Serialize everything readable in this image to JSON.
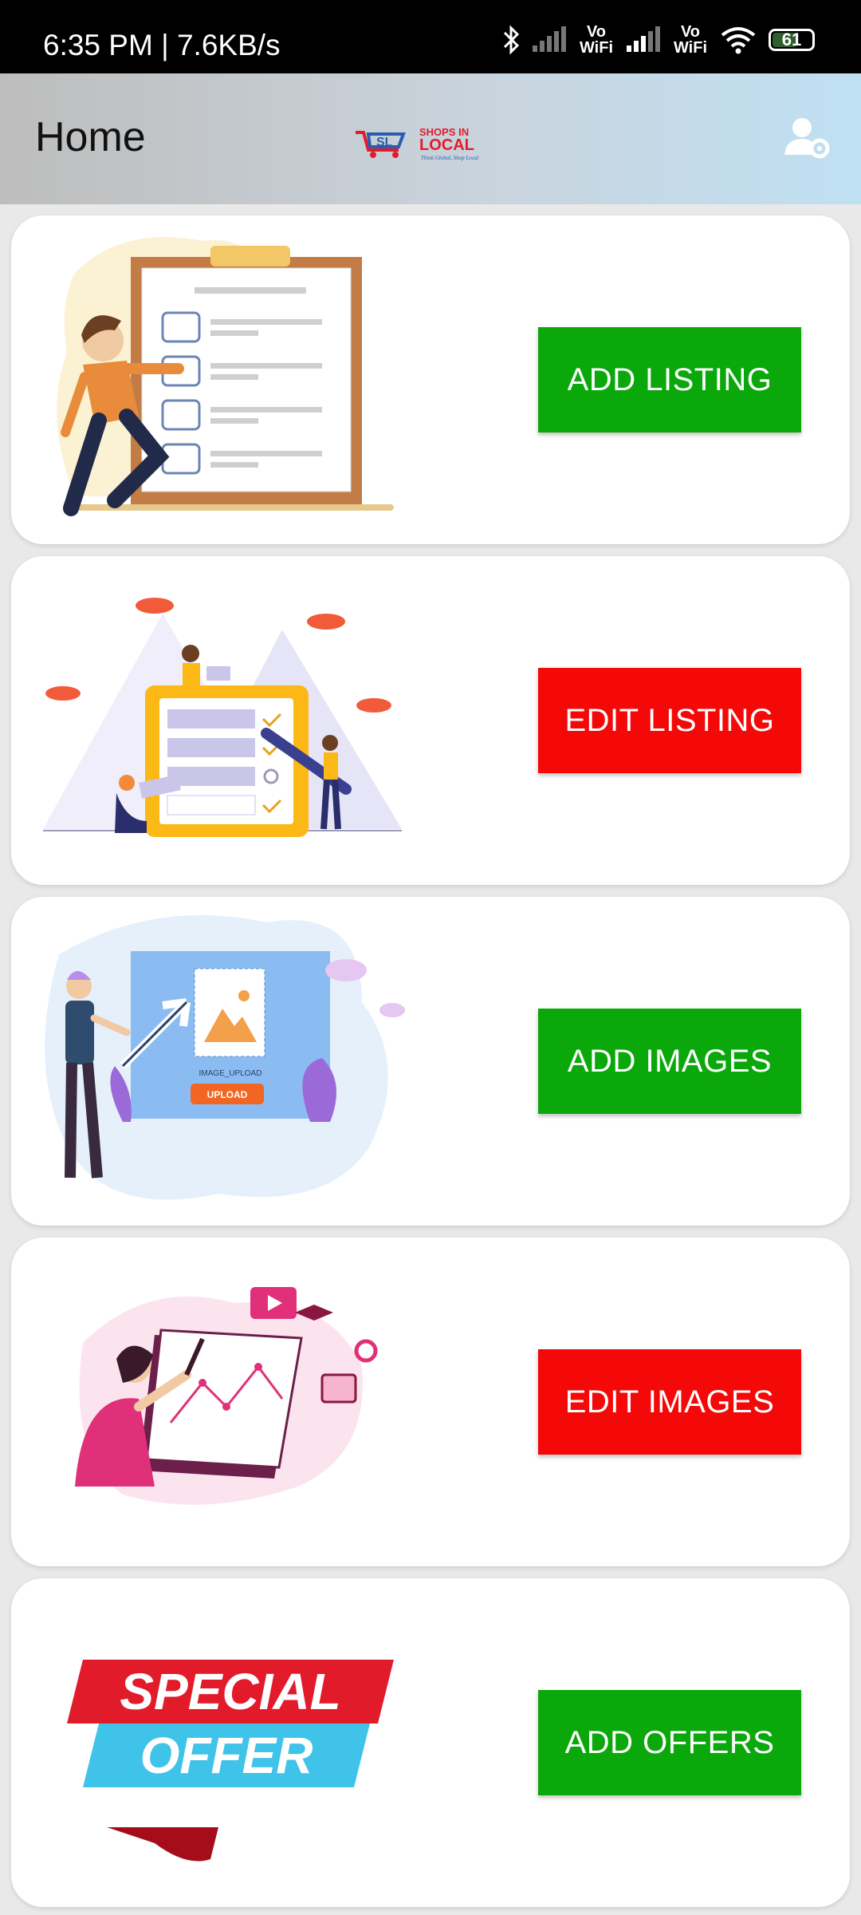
{
  "status_bar": {
    "time_speed": "6:35 PM | 7.6KB/s",
    "vo_wifi_1": "Vo WiFi",
    "vo_wifi_2": "Vo WiFi",
    "battery": "61"
  },
  "header": {
    "title": "Home",
    "logo_text_top": "SHOPS IN",
    "logo_text_main": "LOCAL",
    "logo_tagline": "Think Global, Shop Local",
    "logo_initials": "SL"
  },
  "cards": [
    {
      "button_label": "ADD LISTING",
      "button_color": "#0aa80a",
      "illustration": "clipboard-checklist-illustration"
    },
    {
      "button_label": "EDIT LISTING",
      "button_color": "#f40808",
      "illustration": "team-editing-list-illustration"
    },
    {
      "button_label": "ADD IMAGES",
      "button_color": "#0aa80a",
      "illustration": "image-upload-illustration",
      "upload_caption": "IMAGE_UPLOAD",
      "upload_button": "UPLOAD"
    },
    {
      "button_label": "EDIT IMAGES",
      "button_color": "#f40808",
      "illustration": "graphic-editing-illustration"
    },
    {
      "button_label": "ADD OFFERS",
      "button_color": "#0aa80a",
      "illustration": "special-offer-banner",
      "banner_line1": "SPECIAL",
      "banner_line2": "OFFER"
    }
  ],
  "colors": {
    "green": "#0aa80a",
    "red": "#f40808",
    "brand_red": "#e21b2b",
    "brand_blue": "#2a5db0"
  }
}
